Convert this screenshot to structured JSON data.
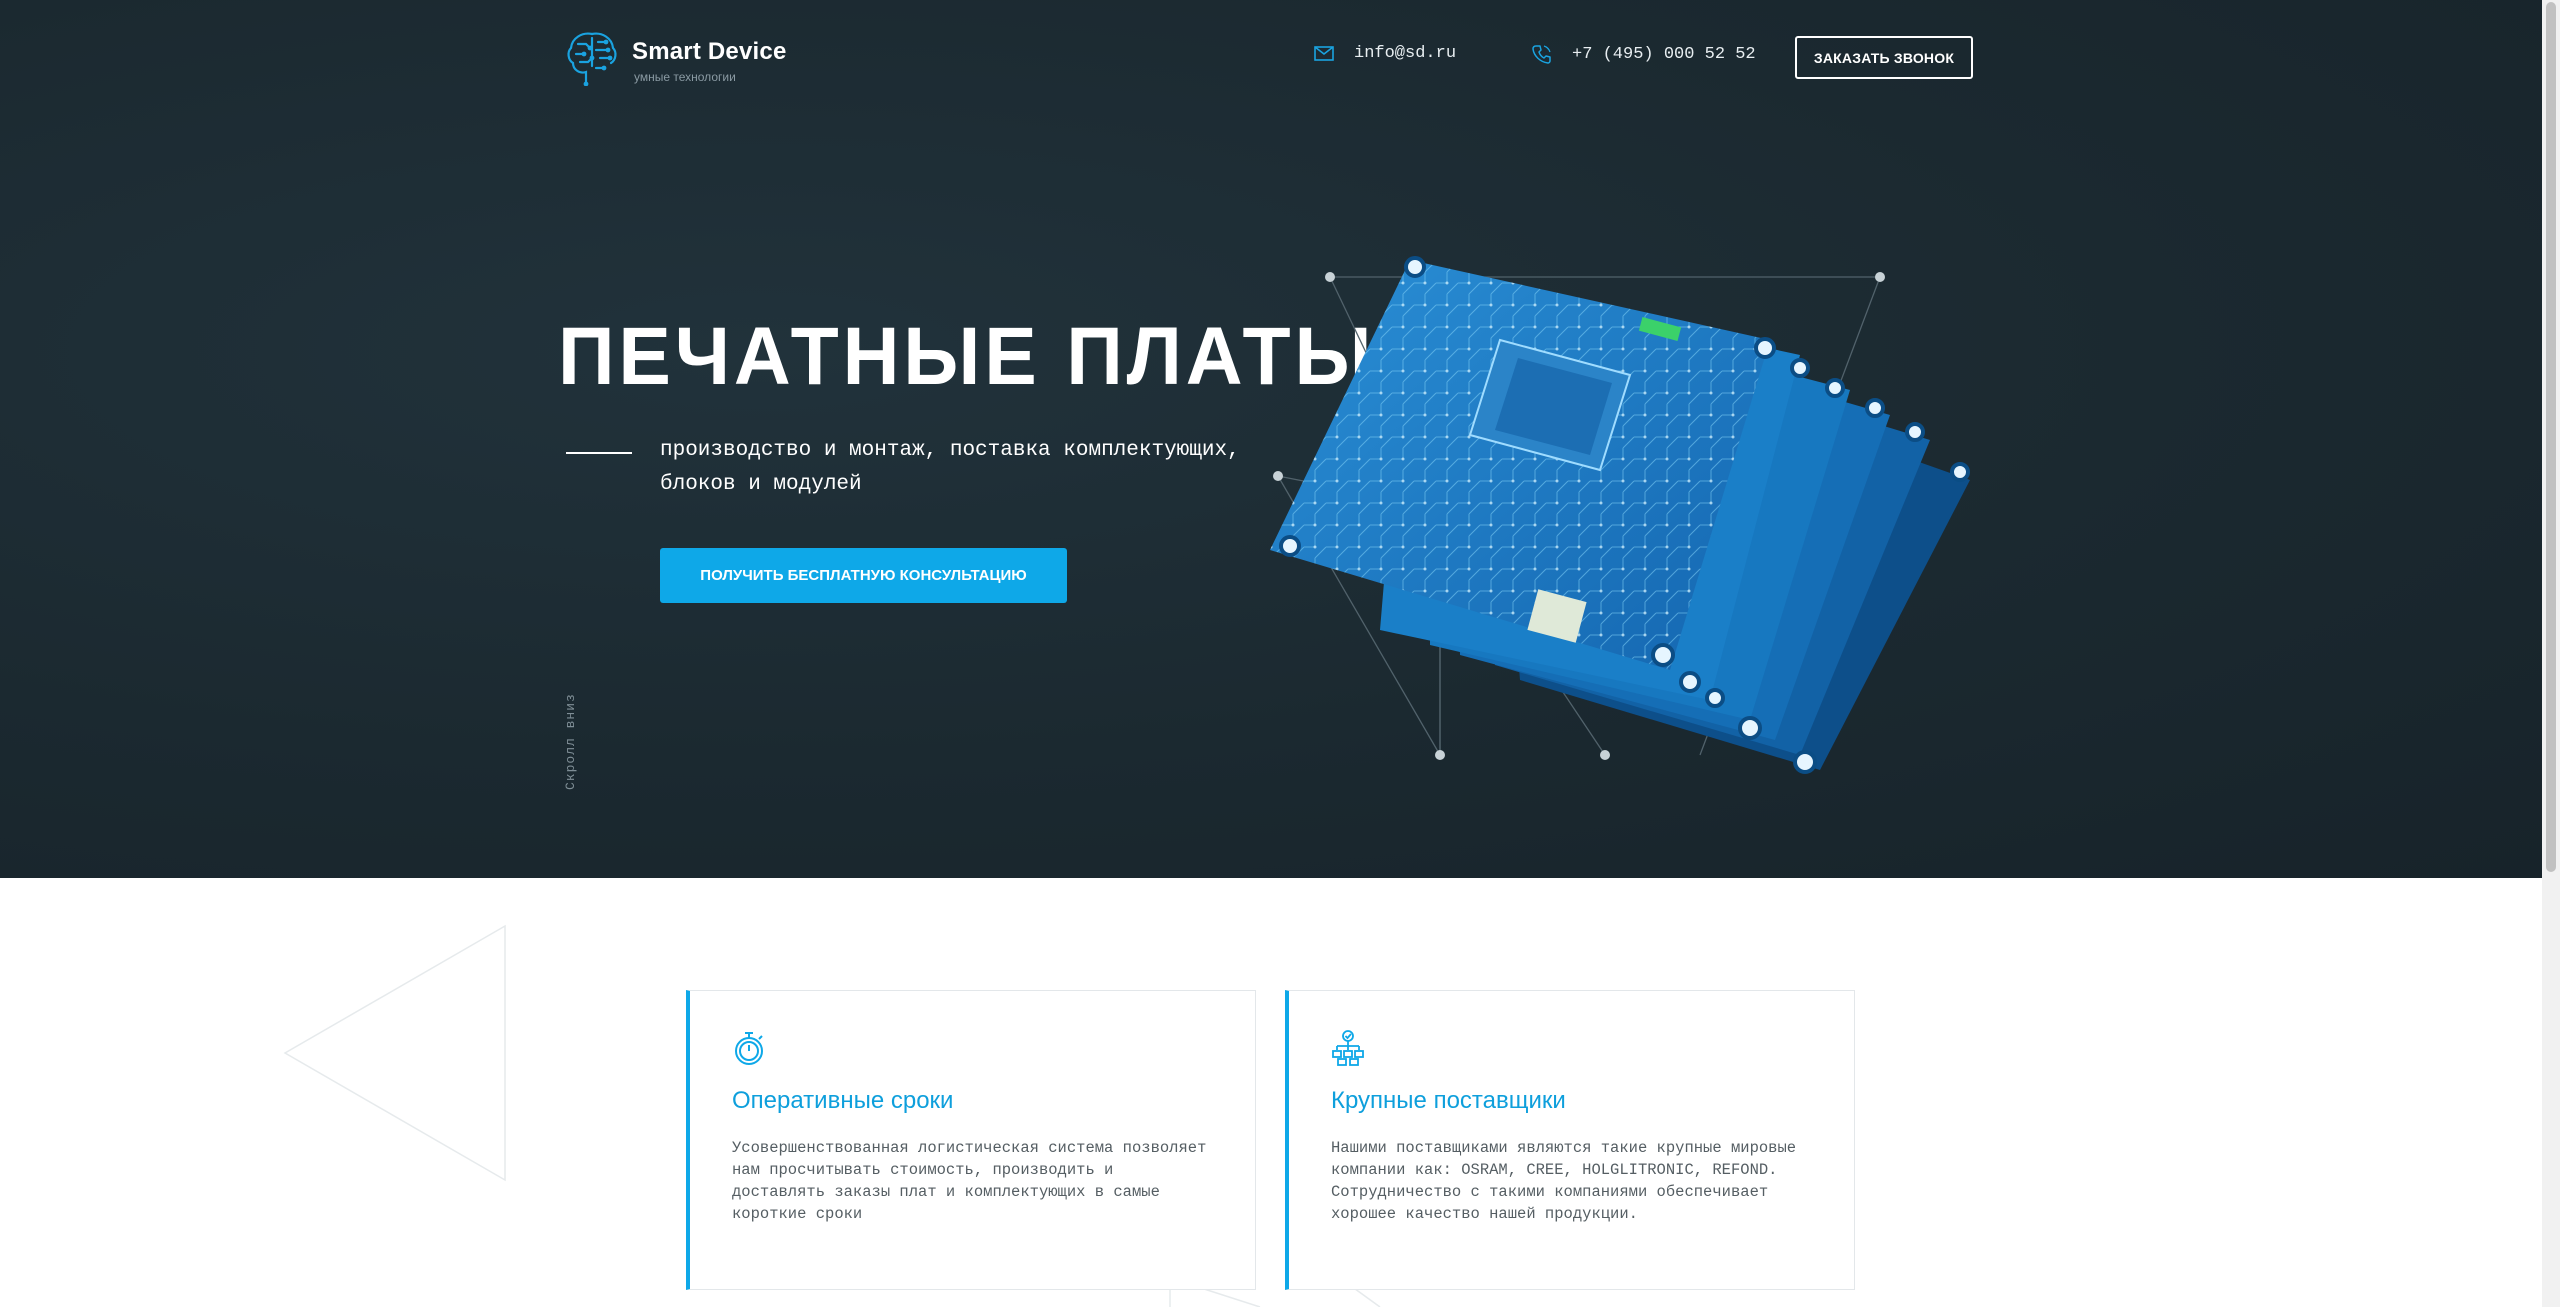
{
  "header": {
    "logo_title": "Smart Device",
    "logo_subtitle": "умные технологии",
    "email": "info@sd.ru",
    "phone": "+7 (495) 000 52 52",
    "callback_button": "ЗАКАЗАТЬ ЗВОНОК",
    "icons": [
      "brain-circuit-logo-icon",
      "mail-icon",
      "phone-icon"
    ]
  },
  "hero": {
    "title": "ПЕЧАТНЫЕ ПЛАТЫ",
    "subtitle": "производство и монтаж, поставка комплектующих, блоков и модулей",
    "cta_button": "ПОЛУЧИТЬ БЕСПЛАТНУЮ КОНСУЛЬТАЦИЮ",
    "scroll_hint": "Скролл вниз"
  },
  "features": [
    {
      "icon": "stopwatch-icon",
      "title": "Оперативные сроки",
      "text": "Усовершенствованная логистическая система позволяет нам просчитывать стоимость, производить и доставлять заказы плат и комплектующих в самые короткие сроки"
    },
    {
      "icon": "suppliers-network-icon",
      "title": "Крупные поставщики",
      "text": "Нашими поставщиками являются такие крупные мировые компании как: OSRAM, CREE, HOLGLITRONIC, REFOND. Сотрудничество с такими компаниями обеспечивает хорошее качество нашей продукции."
    }
  ],
  "colors": {
    "hero_bg": "#1b2930",
    "accent": "#0ea8e8",
    "feature_title": "#0e9fdc",
    "pcb_blue": "#1b7fc8"
  }
}
